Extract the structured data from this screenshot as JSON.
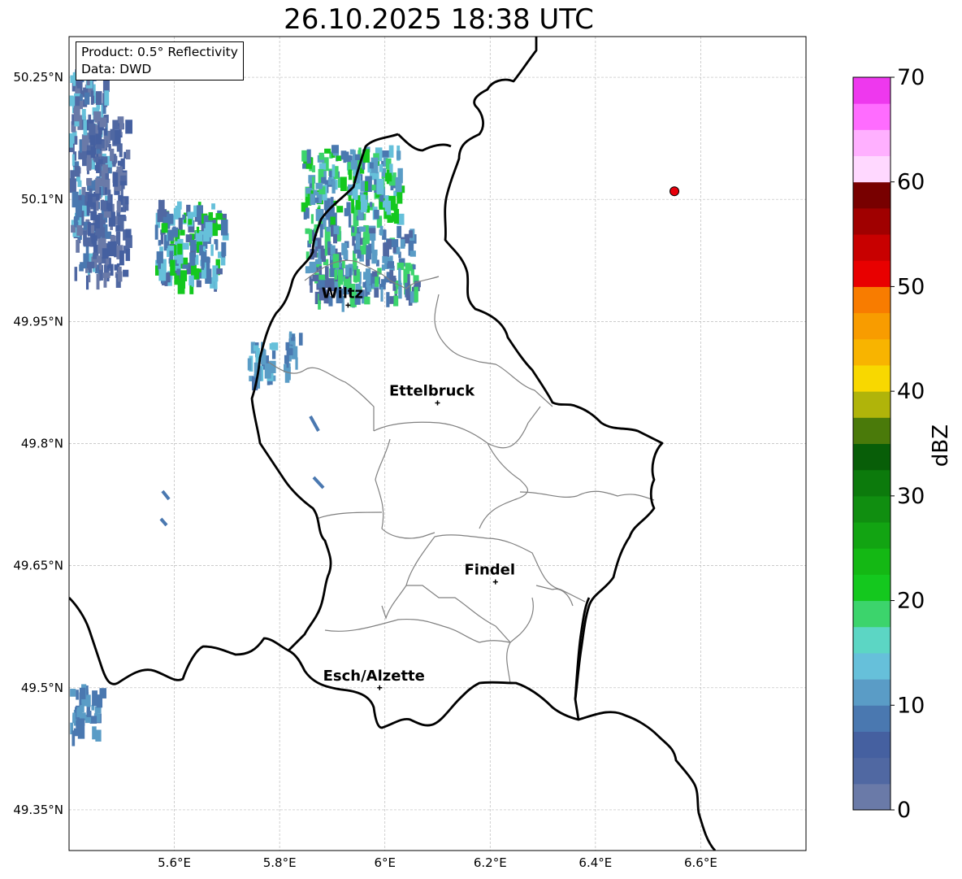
{
  "title": "26.10.2025 18:38 UTC",
  "info": {
    "product": "Product: 0.5° Reflectivity",
    "source": "Data: DWD"
  },
  "map": {
    "lon_range": [
      5.4,
      6.8
    ],
    "lat_range": [
      49.3,
      50.3
    ],
    "lon_ticks": [
      "5.6°E",
      "5.8°E",
      "6°E",
      "6.2°E",
      "6.4°E",
      "6.6°E"
    ],
    "lat_ticks": [
      "49.35°N",
      "49.5°N",
      "49.65°N",
      "49.8°N",
      "49.95°N",
      "50.1°N",
      "50.25°N"
    ],
    "cities": [
      {
        "name": "Wiltz",
        "lon": 5.93,
        "lat": 49.97
      },
      {
        "name": "Ettelbruck",
        "lon": 6.1,
        "lat": 49.85
      },
      {
        "name": "Findel",
        "lon": 6.21,
        "lat": 49.63
      },
      {
        "name": "Esch/Alzette",
        "lon": 5.99,
        "lat": 49.5
      }
    ],
    "radar_site": {
      "lon": 6.55,
      "lat": 50.11,
      "color": "#e8000b"
    }
  },
  "colorbar": {
    "label": "dBZ",
    "min": 0,
    "max": 70,
    "step": 2.5,
    "tick_labels": [
      "0",
      "10",
      "20",
      "30",
      "40",
      "50",
      "60",
      "70"
    ],
    "colors": [
      "#6a7aa8",
      "#5068a2",
      "#4560a0",
      "#4a78b0",
      "#5a9cc6",
      "#66c0da",
      "#5cd6c4",
      "#3cd46c",
      "#14c81e",
      "#14b814",
      "#12a412",
      "#108e10",
      "#0c7a0c",
      "#085e08",
      "#4a7a0a",
      "#b0b40a",
      "#f8d800",
      "#f8b400",
      "#f89c00",
      "#f87c00",
      "#e80000",
      "#c80000",
      "#a00000",
      "#780000",
      "#ffd8ff",
      "#ffb0ff",
      "#ff6cff",
      "#ee38ee"
    ]
  }
}
